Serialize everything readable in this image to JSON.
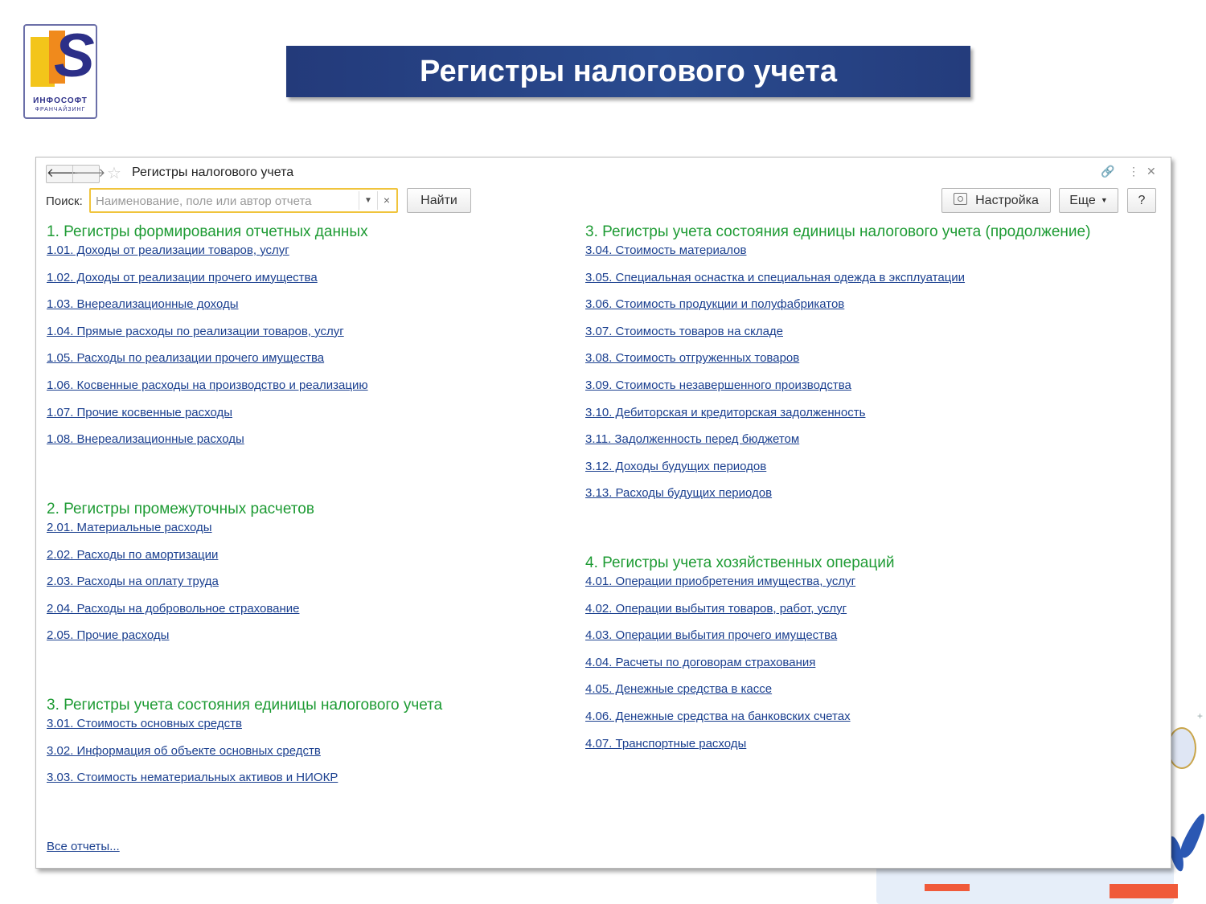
{
  "logo": {
    "brand": "ИНФОСОФТ",
    "sub": "ФРАНЧАЙЗИНГ"
  },
  "slide_title": "Регистры налогового учета",
  "window": {
    "title": "Регистры налогового учета",
    "search": {
      "label": "Поиск:",
      "placeholder": "Наименование, поле или автор отчета",
      "value": ""
    },
    "find_label": "Найти",
    "settings_label": "Настройка",
    "more_label": "Еще",
    "help_label": "?",
    "all_reports": "Все отчеты..."
  },
  "sections": [
    {
      "title": "1. Регистры формирования отчетных данных",
      "items": [
        "1.01. Доходы от реализации товаров, услуг",
        "1.02. Доходы от реализации прочего имущества",
        "1.03. Внереализационные доходы",
        "1.04. Прямые расходы по реализации товаров, услуг",
        "1.05. Расходы по реализации прочего имущества",
        "1.06. Косвенные расходы на производство и реализацию",
        "1.07. Прочие косвенные расходы",
        "1.08. Внереализационные расходы"
      ]
    },
    {
      "title": "2. Регистры промежуточных расчетов",
      "items": [
        "2.01. Материальные расходы",
        "2.02. Расходы по амортизации",
        "2.03. Расходы на оплату труда",
        "2.04. Расходы на добровольное страхование",
        "2.05. Прочие расходы"
      ]
    },
    {
      "title": "3. Регистры учета состояния единицы налогового учета",
      "items": [
        "3.01. Стоимость основных средств",
        "3.02. Информация об объекте основных средств",
        "3.03. Стоимость нематериальных активов и НИОКР"
      ]
    },
    {
      "title": "3. Регистры учета состояния единицы налогового учета (продолжение)",
      "items": [
        "3.04. Стоимость материалов",
        "3.05. Специальная оснастка и специальная одежда в эксплуатации",
        "3.06. Стоимость продукции и полуфабрикатов",
        "3.07. Стоимость товаров на складе",
        "3.08. Стоимость отгруженных товаров",
        "3.09. Стоимость незавершенного производства",
        "3.10. Дебиторская и кредиторская задолженность",
        "3.11. Задолженность перед бюджетом",
        "3.12. Доходы будущих периодов",
        "3.13. Расходы будущих периодов"
      ]
    },
    {
      "title": "4. Регистры учета хозяйственных операций",
      "items": [
        "4.01. Операции приобретения имущества, услуг",
        "4.02. Операции выбытия товаров, работ, услуг",
        "4.03. Операции выбытия прочего имущества",
        "4.04. Расчеты по договорам страхования",
        "4.05. Денежные средства в кассе",
        "4.06. Денежные средства на банковских счетах",
        "4.07. Транспортные расходы"
      ]
    }
  ],
  "colors": {
    "section_title": "#1e9b34",
    "link": "#1a3f8f",
    "title_bar": "#233a7a",
    "search_border": "#f0c43c"
  }
}
